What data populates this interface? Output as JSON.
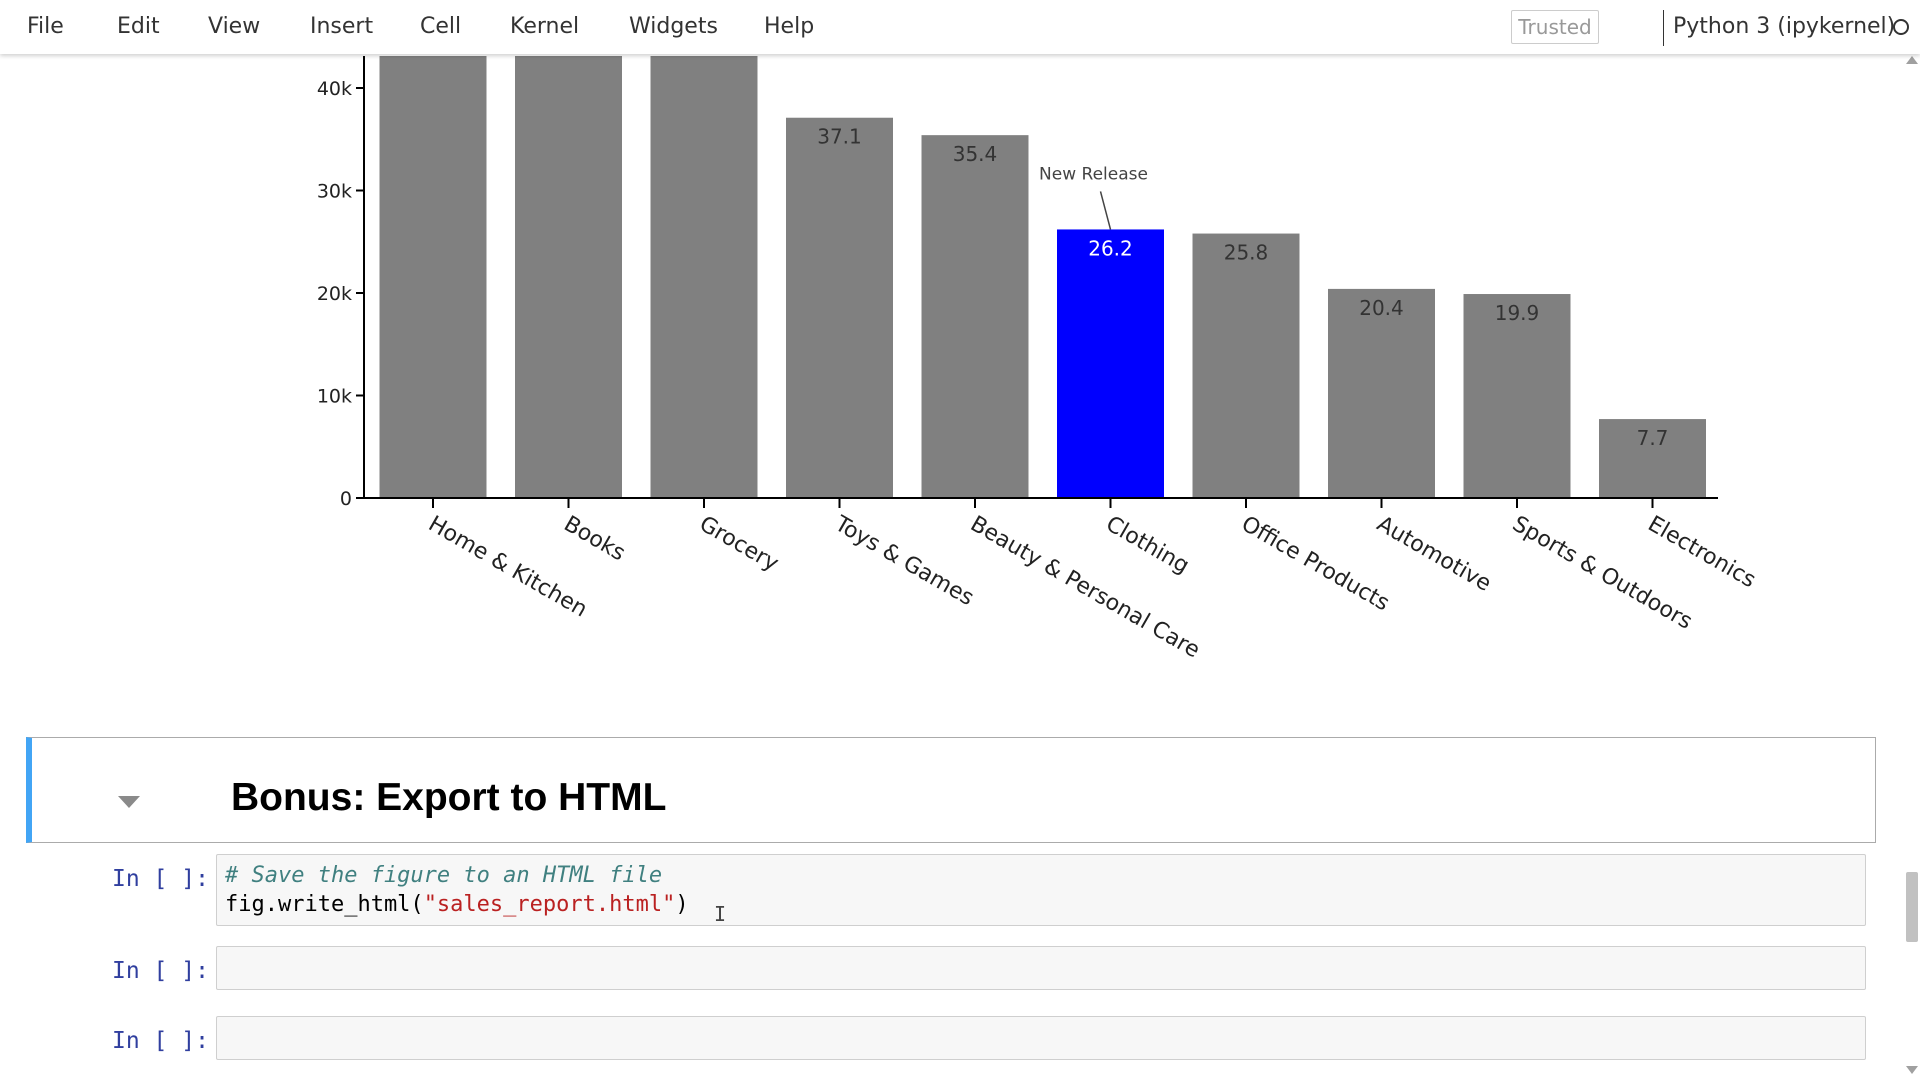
{
  "menu": {
    "items": [
      {
        "label": "File"
      },
      {
        "label": "Edit"
      },
      {
        "label": "View"
      },
      {
        "label": "Insert"
      },
      {
        "label": "Cell"
      },
      {
        "label": "Kernel"
      },
      {
        "label": "Widgets"
      },
      {
        "label": "Help"
      }
    ],
    "trusted": "Trusted",
    "kernel": "Python 3 (ipykernel)"
  },
  "chart_data": {
    "type": "bar",
    "categories": [
      "Home & Kitchen",
      "Books",
      "Grocery",
      "Toys & Games",
      "Beauty & Personal Care",
      "Clothing",
      "Office Products",
      "Automotive",
      "Sports & Outdoors",
      "Electronics"
    ],
    "values": [
      50000,
      50000,
      50000,
      37100,
      35400,
      26200,
      25800,
      20400,
      19900,
      7700
    ],
    "value_labels": [
      "",
      "",
      "",
      "37.1",
      "35.4",
      "26.2",
      "25.8",
      "20.4",
      "19.9",
      "7.7"
    ],
    "highlight_index": 5,
    "colors": {
      "default": "#808080",
      "highlight": "#0000ff"
    },
    "annotation": {
      "text": "New Release",
      "category": "Clothing"
    },
    "y_ticks": [
      0,
      10000,
      20000,
      30000,
      40000
    ],
    "y_tick_labels": [
      "0",
      "10k",
      "20k",
      "30k",
      "40k"
    ],
    "ylim": [
      0,
      43000
    ],
    "xlabel": "",
    "ylabel": ""
  },
  "markdown": {
    "heading": "Bonus: Export to HTML"
  },
  "cells": [
    {
      "prompt": "In [ ]:",
      "comment": "# Save the figure to an HTML file",
      "code_fn": "fig.write_html(",
      "code_str": "\"sales_report.html\"",
      "code_end": ")"
    },
    {
      "prompt": "In [ ]:"
    },
    {
      "prompt": "In [ ]:"
    }
  ]
}
